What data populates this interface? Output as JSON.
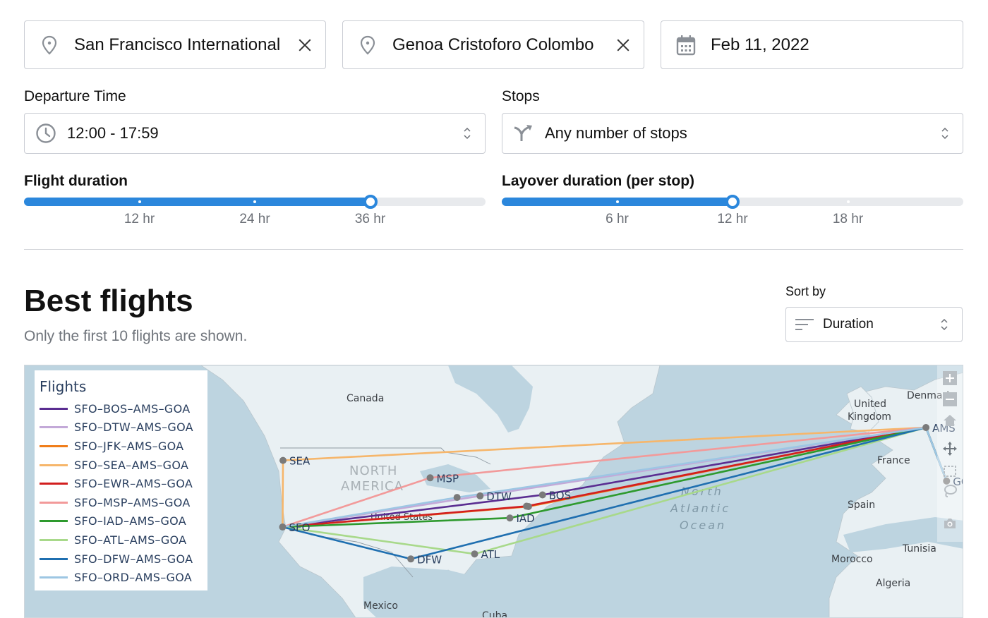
{
  "search": {
    "origin": {
      "value": "San Francisco International",
      "icon": "map-pin-icon",
      "clear_icon": "close-icon"
    },
    "destination": {
      "value": "Genoa Cristoforo Colombo",
      "icon": "map-pin-icon",
      "clear_icon": "close-icon"
    },
    "date": {
      "value": "Feb 11, 2022",
      "icon": "calendar-icon"
    }
  },
  "filters": {
    "departure_time": {
      "label": "Departure Time",
      "value": "12:00 - 17:59",
      "icon": "clock-icon"
    },
    "stops": {
      "label": "Stops",
      "value": "Any number of stops",
      "icon": "merge-arrow-icon"
    },
    "flight_duration": {
      "label": "Flight duration",
      "ticks": [
        "12 hr",
        "24 hr",
        "36 hr"
      ],
      "tick_values_hr": [
        12,
        24,
        36
      ],
      "range_hr": [
        0,
        48
      ],
      "value_hr": 36
    },
    "layover_duration": {
      "label": "Layover duration (per stop)",
      "ticks": [
        "6 hr",
        "12 hr",
        "18 hr"
      ],
      "tick_values_hr": [
        6,
        12,
        18
      ],
      "range_hr": [
        0,
        24
      ],
      "value_hr": 12
    }
  },
  "results": {
    "title": "Best flights",
    "subtitle": "Only the first 10 flights are shown.",
    "sort": {
      "label": "Sort by",
      "value": "Duration",
      "icon": "sort-icon"
    }
  },
  "map": {
    "legend_title": "Flights",
    "flights": [
      {
        "label": "SFO–BOS–AMS–GOA",
        "via": "BOS",
        "color": "#5a2d91"
      },
      {
        "label": "SFO–DTW–AMS–GOA",
        "via": "DTW",
        "color": "#c3a9d8"
      },
      {
        "label": "SFO–JFK–AMS–GOA",
        "via": "JFK",
        "color": "#f07d1a"
      },
      {
        "label": "SFO–SEA–AMS–GOA",
        "via": "SEA",
        "color": "#f6b66b"
      },
      {
        "label": "SFO–EWR–AMS–GOA",
        "via": "EWR",
        "color": "#d21f1f"
      },
      {
        "label": "SFO–MSP–AMS–GOA",
        "via": "MSP",
        "color": "#f29a9a"
      },
      {
        "label": "SFO–IAD–AMS–GOA",
        "via": "IAD",
        "color": "#2e9a2e"
      },
      {
        "label": "SFO–ATL–AMS–GOA",
        "via": "ATL",
        "color": "#a8d98a"
      },
      {
        "label": "SFO–DFW–AMS–GOA",
        "via": "DFW",
        "color": "#1f6fb0"
      },
      {
        "label": "SFO–ORD–AMS–GOA",
        "via": "ORD",
        "color": "#9dc6e3"
      }
    ],
    "airports": [
      {
        "code": "SEA",
        "lat": 47.45,
        "lon": -122.3,
        "show_label": true
      },
      {
        "code": "SFO",
        "lat": 37.62,
        "lon": -122.38,
        "show_label": true
      },
      {
        "code": "MSP",
        "lat": 44.88,
        "lon": -93.22,
        "show_label": true
      },
      {
        "code": "ORD",
        "lat": 41.98,
        "lon": -87.9,
        "show_label": false
      },
      {
        "code": "DTW",
        "lat": 42.21,
        "lon": -83.35,
        "show_label": true
      },
      {
        "code": "BOS",
        "lat": 42.36,
        "lon": -71.01,
        "show_label": true
      },
      {
        "code": "JFK",
        "lat": 40.64,
        "lon": -73.78,
        "show_label": false
      },
      {
        "code": "EWR",
        "lat": 40.69,
        "lon": -74.17,
        "show_label": false
      },
      {
        "code": "IAD",
        "lat": 38.95,
        "lon": -77.46,
        "show_label": true
      },
      {
        "code": "ATL",
        "lat": 33.64,
        "lon": -84.43,
        "show_label": true
      },
      {
        "code": "DFW",
        "lat": 32.9,
        "lon": -97.04,
        "show_label": true
      },
      {
        "code": "AMS",
        "lat": 52.31,
        "lon": 4.77,
        "show_label": true
      },
      {
        "code": "GOA",
        "lat": 44.41,
        "lon": 8.84,
        "show_label": true
      }
    ],
    "place_labels": [
      {
        "text": "Canada",
        "kind": "country"
      },
      {
        "text": "NORTH",
        "kind": "continent"
      },
      {
        "text": "AMERICA",
        "kind": "continent"
      },
      {
        "text": "United States",
        "kind": "country"
      },
      {
        "text": "Mexico",
        "kind": "country"
      },
      {
        "text": "Cuba",
        "kind": "country"
      },
      {
        "text": "North",
        "kind": "ocean"
      },
      {
        "text": "Atlantic",
        "kind": "ocean"
      },
      {
        "text": "Ocean",
        "kind": "ocean"
      },
      {
        "text": "United",
        "kind": "country"
      },
      {
        "text": "Kingdom",
        "kind": "country"
      },
      {
        "text": "Denmark",
        "kind": "country"
      },
      {
        "text": "France",
        "kind": "country"
      },
      {
        "text": "Spain",
        "kind": "country"
      },
      {
        "text": "Morocco",
        "kind": "country"
      },
      {
        "text": "Tunisia",
        "kind": "country"
      },
      {
        "text": "Algeria",
        "kind": "country"
      }
    ],
    "modebar": [
      "zoom-in-icon",
      "zoom-out-icon",
      "home-icon",
      "pan-icon",
      "box-select-icon",
      "lasso-icon",
      "camera-icon"
    ]
  }
}
